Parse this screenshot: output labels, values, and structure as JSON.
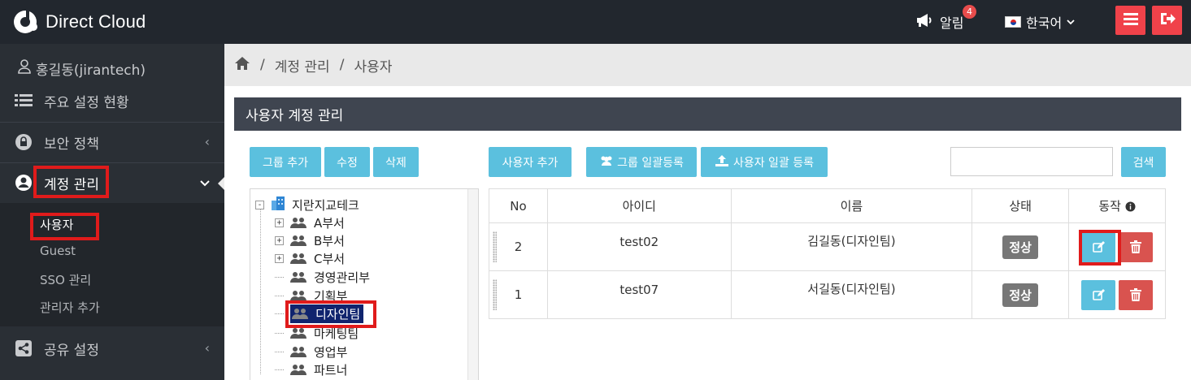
{
  "app": {
    "brand": "Direct Cloud",
    "alarm_label": "알림",
    "alarm_count": "4",
    "language": "한국어"
  },
  "sidebar": {
    "user": "홍길동(jirantech)",
    "items": [
      {
        "label": "주요 설정 현황",
        "icon": "list-icon"
      },
      {
        "label": "보안 정책",
        "icon": "lock-icon"
      },
      {
        "label": "계정 관리",
        "icon": "user-circle-icon"
      },
      {
        "label": "공유 설정",
        "icon": "share-icon"
      }
    ],
    "sub_items": [
      "사용자",
      "Guest",
      "SSO 관리",
      "관리자 추가"
    ]
  },
  "breadcrumb": {
    "level1": "계정 관리",
    "level2": "사용자"
  },
  "panel": {
    "title": "사용자 계정 관리",
    "buttons": {
      "group_add": "그룹 추가",
      "edit": "수정",
      "delete": "삭제",
      "user_add": "사용자 추가",
      "group_bulk": "그룹 일괄등록",
      "user_bulk": "사용자 일괄 등록",
      "search": "검색"
    },
    "search_value": ""
  },
  "tree": {
    "root": "지란지교테크",
    "nodes": [
      "A부서",
      "B부서",
      "C부서",
      "경영관리부",
      "기획부",
      "디자인팀",
      "마케팅팀",
      "영업부",
      "파트너"
    ],
    "selected": "디자인팀"
  },
  "table": {
    "headers": [
      "No",
      "아이디",
      "이름",
      "상태",
      "동작"
    ],
    "rows": [
      {
        "no": "2",
        "id": "test02",
        "name": "김길동(디자인팀)",
        "status": "정상"
      },
      {
        "no": "1",
        "id": "test07",
        "name": "서길동(디자인팀)",
        "status": "정상"
      }
    ]
  },
  "colors": {
    "topbar": "#22272e",
    "sidebar": "#2a2f35",
    "accent_button": "#5bc0de",
    "danger": "#d9534f",
    "top_red": "#f0424a",
    "highlight": "#e01b1b"
  }
}
